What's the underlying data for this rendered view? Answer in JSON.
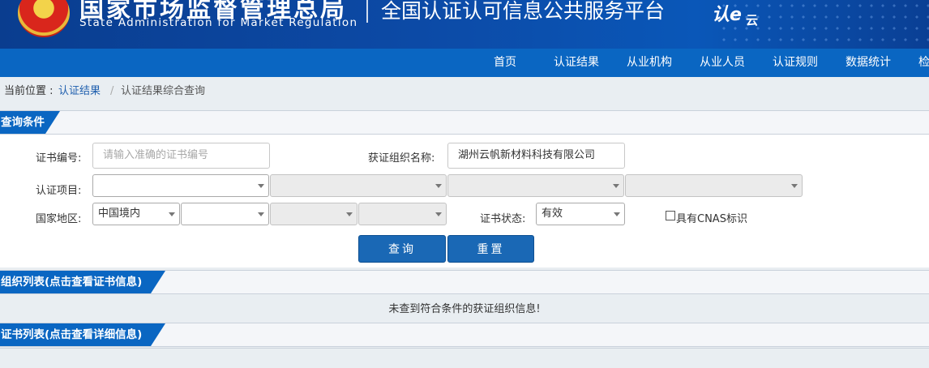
{
  "header": {
    "agency_cn": "国家市场监督管理总局",
    "agency_en": "State Administration  for  Market Regulation",
    "platform_title": "全国认证认可信息公共服务平台",
    "logo_ren": "认e",
    "logo_yun": "云"
  },
  "nav": {
    "items": [
      {
        "label": "首页"
      },
      {
        "label": "认证结果"
      },
      {
        "label": "从业机构"
      },
      {
        "label": "从业人员"
      },
      {
        "label": "认证规则"
      },
      {
        "label": "数据统计"
      },
      {
        "label": "检"
      }
    ]
  },
  "breadcrumb": {
    "prefix": "当前位置 :",
    "link": "认证结果",
    "separator": "/",
    "current": "认证结果综合查询"
  },
  "query": {
    "section_title": "查询条件",
    "cert_no": {
      "label": "证书编号:",
      "placeholder": "请输入准确的证书编号",
      "value": ""
    },
    "org_name": {
      "label": "获证组织名称:",
      "value": "湖州云帆新材料科技有限公司"
    },
    "project": {
      "label": "认证项目:",
      "selects": [
        "",
        "",
        "",
        ""
      ]
    },
    "region": {
      "label": "国家地区:",
      "selects": [
        "中国境内",
        "",
        "",
        ""
      ]
    },
    "status": {
      "label": "证书状态:",
      "value": "有效"
    },
    "cnas": {
      "label": "具有CNAS标识",
      "checked": false
    },
    "search_label": "查询",
    "reset_label": "重置"
  },
  "org_list": {
    "section_title": "组织列表(点击查看证书信息)",
    "empty_message": "未查到符合条件的获证组织信息!"
  },
  "cert_list": {
    "section_title": "证书列表(点击查看详细信息)"
  },
  "colors": {
    "primary_blue": "#0a66c2",
    "banner_blue": "#0c4aa6",
    "button_blue": "#1a68b5"
  }
}
